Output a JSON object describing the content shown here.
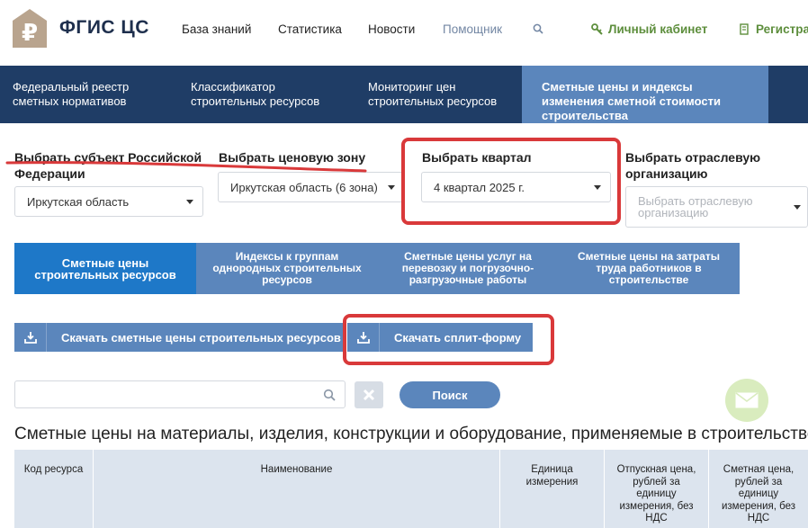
{
  "header": {
    "logo_text": "ФГИС ЦС",
    "nav": [
      "База знаний",
      "Статистика",
      "Новости",
      "Помощник"
    ],
    "cabinet": "Личный кабинет",
    "register": "Регистрация"
  },
  "main_nav": [
    {
      "label": "Федеральный реестр сметных нормативов"
    },
    {
      "label": "Классификатор строительных ресурсов"
    },
    {
      "label": "Мониторинг цен строительных ресурсов"
    },
    {
      "label": "Сметные цены и индексы изменения сметной стоимости строительства",
      "active": true
    }
  ],
  "filters": {
    "subject_label": "Выбрать субъект Российской Федерации",
    "subject_value": "Иркутская область",
    "zone_label": "Выбрать ценовую зону",
    "zone_value": "Иркутская область (6 зона)",
    "quarter_label": "Выбрать квартал",
    "quarter_value": "4 квартал 2025 г.",
    "org_label": "Выбрать отраслевую организацию",
    "org_placeholder": "Выбрать отраслевую организацию"
  },
  "tabs": [
    {
      "label": "Сметные цены строительных ресурсов",
      "active": true
    },
    {
      "label": "Индексы к группам однородных строительных ресурсов"
    },
    {
      "label": "Сметные цены услуг на перевозку и погрузочно-разгрузочные работы"
    },
    {
      "label": "Сметные цены на затраты труда работников в строительстве"
    }
  ],
  "downloads": {
    "prices_label": "Скачать сметные цены строительных ресурсов",
    "split_label": "Скачать сплит-форму"
  },
  "search": {
    "placeholder": "",
    "button_label": "Поиск"
  },
  "section_title": "Сметные цены на материалы, изделия, конструкции и оборудование, применяемые в строительстве",
  "table": {
    "columns": [
      "Код ресурса",
      "Наименование",
      "Единица измерения",
      "Отпускная цена, рублей за единицу измерения, без НДС",
      "Сметная цена, рублей за единицу измерения, без НДС"
    ]
  },
  "colors": {
    "navy": "#1f3d66",
    "nav_active": "#5b86bc",
    "tab_active": "#1e78c8",
    "green": "#5d8e3c",
    "annotation_red": "#d9393a"
  }
}
